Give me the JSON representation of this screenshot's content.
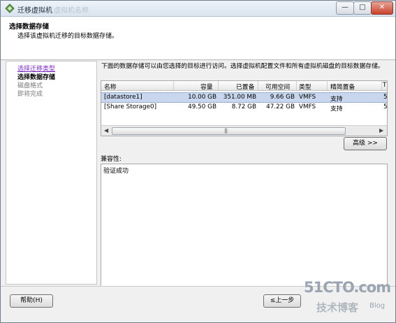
{
  "window": {
    "title": "迁移虚拟机",
    "title_ghost": "虚拟机名称",
    "min_label": "—",
    "max_label": "□",
    "close_label": "✕"
  },
  "header": {
    "title": "选择数据存储",
    "subtitle": "选择该虚拟机迁移的目标数据存储。"
  },
  "steps": [
    {
      "label": "选择迁移类型",
      "state": "link"
    },
    {
      "label": "选择数据存储",
      "state": "current"
    },
    {
      "label": "磁盘格式",
      "state": "future"
    },
    {
      "label": "即将完成",
      "state": "future"
    }
  ],
  "main": {
    "description": "下面的数据存储可以由您选择的目标进行访问。选择虚拟机配置文件和所有虚拟机磁盘的目标数据存储。",
    "table": {
      "columns": [
        "名称",
        "容量",
        "已置备",
        "可用空间",
        "类型",
        "精简置备",
        "T"
      ],
      "rows": [
        {
          "name": "[datastore1]",
          "capacity": "10.00 GB",
          "provisioned": "351.00 MB",
          "free": "9.66 GB",
          "type": "VMFS",
          "thin": "支持",
          "extra": "5",
          "selected": true
        },
        {
          "name": "[Share Storage0]",
          "capacity": "49.50 GB",
          "provisioned": "8.72 GB",
          "free": "47.22 GB",
          "type": "VMFS",
          "thin": "支持",
          "extra": "5",
          "selected": false
        }
      ]
    },
    "advanced_button": "高级 >>",
    "compat_label": "兼容性:",
    "compat_text": "验证成功"
  },
  "footer": {
    "help_button": "帮助(H)",
    "back_button": "≤上一步"
  },
  "watermark": {
    "main": "51CTO.com",
    "sub": "技术博客",
    "blog": "Blog"
  },
  "colors": {
    "selected_row": "#c8d7ee",
    "link": "#7b2bbf",
    "close_button": "#c7412c"
  }
}
